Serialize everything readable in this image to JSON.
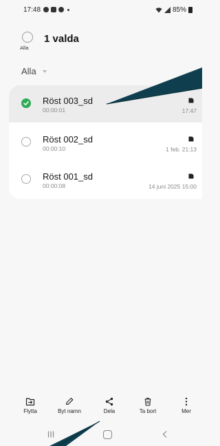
{
  "status_bar": {
    "time": "17:48",
    "battery": "85%",
    "icons": [
      "messenger-icon",
      "calendar-icon",
      "settings-icon",
      "wifi-icon",
      "signal-icon",
      "battery-icon"
    ]
  },
  "selection": {
    "all_label": "Alla",
    "count_label": "1 valda"
  },
  "filter": {
    "label": "Alla"
  },
  "recordings": [
    {
      "name": "Röst 003_sd",
      "duration": "00:00:01",
      "date": "17:47",
      "selected": true,
      "storage_icon": "sd-card-icon"
    },
    {
      "name": "Röst 002_sd",
      "duration": "00:00:10",
      "date": "1 feb. 21:13",
      "selected": false,
      "storage_icon": "sd-card-icon"
    },
    {
      "name": "Röst 001_sd",
      "duration": "00:00:08",
      "date": "14 juni 2025 15:00",
      "selected": false,
      "storage_icon": "sd-card-icon"
    }
  ],
  "toolbar": {
    "move_label": "Flytta",
    "rename_label": "Byt namn",
    "share_label": "Dela",
    "delete_label": "Ta bort",
    "more_label": "Mer"
  },
  "colors": {
    "accent_check": "#2eab56",
    "annotation_arrow": "#0f3f4e",
    "selected_row": "#ececec",
    "background": "#f7f7f7"
  }
}
